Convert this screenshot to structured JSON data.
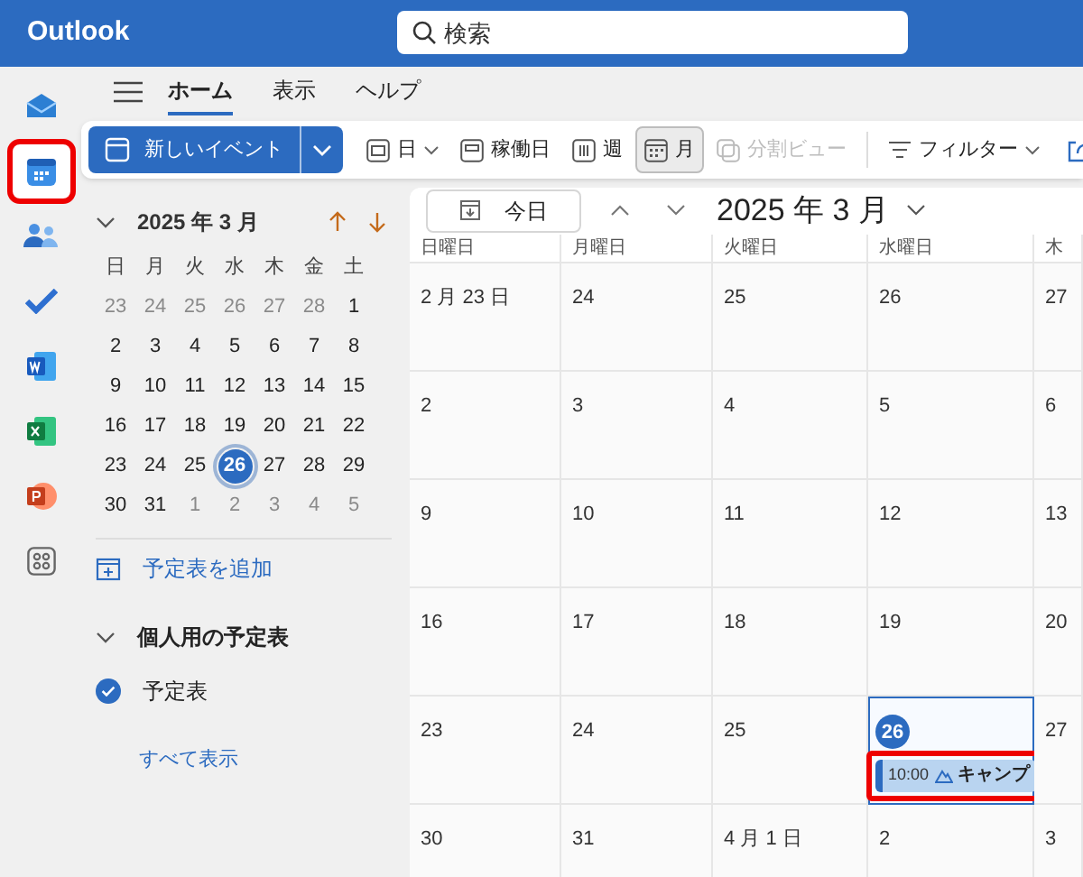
{
  "app_bar": {
    "title": "Outlook",
    "search": {
      "placeholder": "検索"
    }
  },
  "rail": [
    {
      "kind": "mail",
      "selected": false,
      "highlighted": false
    },
    {
      "kind": "calendar",
      "selected": true,
      "highlighted": true
    },
    {
      "kind": "people",
      "selected": false,
      "highlighted": false
    },
    {
      "kind": "todo",
      "selected": false,
      "highlighted": false
    },
    {
      "kind": "word",
      "selected": false,
      "highlighted": false
    },
    {
      "kind": "excel",
      "selected": false,
      "highlighted": false
    },
    {
      "kind": "powerpoint",
      "selected": false,
      "highlighted": false
    },
    {
      "kind": "apps",
      "selected": false,
      "highlighted": false
    }
  ],
  "ribbon_tabs": [
    {
      "label": "ホーム",
      "selected": true
    },
    {
      "label": "表示",
      "selected": false
    },
    {
      "label": "ヘルプ",
      "selected": false
    }
  ],
  "toolbar": {
    "new_event": "新しいイベント",
    "items": [
      {
        "kind": "day",
        "label": "日",
        "selected": false,
        "disabled": false,
        "caret": true
      },
      {
        "kind": "workweek",
        "label": "稼働日",
        "selected": false,
        "disabled": false,
        "caret": false
      },
      {
        "kind": "week",
        "label": "週",
        "selected": false,
        "disabled": false,
        "caret": false
      },
      {
        "kind": "month",
        "label": "月",
        "selected": true,
        "disabled": false,
        "caret": false
      },
      {
        "kind": "split",
        "label": "分割ビュー",
        "selected": false,
        "disabled": true,
        "caret": false
      },
      {
        "kind": "filter",
        "label": "フィルター",
        "selected": false,
        "disabled": false,
        "caret": true
      }
    ]
  },
  "mini_calendar": {
    "title": "2025 年 3 月",
    "weekdays": [
      "日",
      "月",
      "火",
      "水",
      "木",
      "金",
      "土"
    ],
    "weeks": [
      [
        {
          "day": "23",
          "other_month": true,
          "selected": false
        },
        {
          "day": "24",
          "other_month": true,
          "selected": false
        },
        {
          "day": "25",
          "other_month": true,
          "selected": false
        },
        {
          "day": "26",
          "other_month": true,
          "selected": false
        },
        {
          "day": "27",
          "other_month": true,
          "selected": false
        },
        {
          "day": "28",
          "other_month": true,
          "selected": false
        },
        {
          "day": "1",
          "other_month": false,
          "selected": false
        }
      ],
      [
        {
          "day": "2",
          "other_month": false,
          "selected": false
        },
        {
          "day": "3",
          "other_month": false,
          "selected": false
        },
        {
          "day": "4",
          "other_month": false,
          "selected": false
        },
        {
          "day": "5",
          "other_month": false,
          "selected": false
        },
        {
          "day": "6",
          "other_month": false,
          "selected": false
        },
        {
          "day": "7",
          "other_month": false,
          "selected": false
        },
        {
          "day": "8",
          "other_month": false,
          "selected": false
        }
      ],
      [
        {
          "day": "9",
          "other_month": false,
          "selected": false
        },
        {
          "day": "10",
          "other_month": false,
          "selected": false
        },
        {
          "day": "11",
          "other_month": false,
          "selected": false
        },
        {
          "day": "12",
          "other_month": false,
          "selected": false
        },
        {
          "day": "13",
          "other_month": false,
          "selected": false
        },
        {
          "day": "14",
          "other_month": false,
          "selected": false
        },
        {
          "day": "15",
          "other_month": false,
          "selected": false
        }
      ],
      [
        {
          "day": "16",
          "other_month": false,
          "selected": false
        },
        {
          "day": "17",
          "other_month": false,
          "selected": false
        },
        {
          "day": "18",
          "other_month": false,
          "selected": false
        },
        {
          "day": "19",
          "other_month": false,
          "selected": false
        },
        {
          "day": "20",
          "other_month": false,
          "selected": false
        },
        {
          "day": "21",
          "other_month": false,
          "selected": false
        },
        {
          "day": "22",
          "other_month": false,
          "selected": false
        }
      ],
      [
        {
          "day": "23",
          "other_month": false,
          "selected": false
        },
        {
          "day": "24",
          "other_month": false,
          "selected": false
        },
        {
          "day": "25",
          "other_month": false,
          "selected": false
        },
        {
          "day": "26",
          "other_month": false,
          "selected": true
        },
        {
          "day": "27",
          "other_month": false,
          "selected": false
        },
        {
          "day": "28",
          "other_month": false,
          "selected": false
        },
        {
          "day": "29",
          "other_month": false,
          "selected": false
        }
      ],
      [
        {
          "day": "30",
          "other_month": false,
          "selected": false
        },
        {
          "day": "31",
          "other_month": false,
          "selected": false
        },
        {
          "day": "1",
          "other_month": true,
          "selected": false
        },
        {
          "day": "2",
          "other_month": true,
          "selected": false
        },
        {
          "day": "3",
          "other_month": true,
          "selected": false
        },
        {
          "day": "4",
          "other_month": true,
          "selected": false
        },
        {
          "day": "5",
          "other_month": true,
          "selected": false
        }
      ]
    ]
  },
  "add_calendar": "予定表を追加",
  "calendar_group": {
    "title": "個人用の予定表",
    "expanded": true,
    "calendars": [
      {
        "name": "予定表",
        "checked": true
      }
    ]
  },
  "show_all": "すべて表示",
  "month_view": {
    "today_button": "今日",
    "title": "2025 年 3 月",
    "weekdays": [
      "日曜日",
      "月曜日",
      "火曜日",
      "水曜日",
      "木"
    ],
    "weeks": [
      [
        {
          "date": "2 月 23 日",
          "selected": false
        },
        {
          "date": "24",
          "selected": false
        },
        {
          "date": "25",
          "selected": false
        },
        {
          "date": "26",
          "selected": false
        },
        {
          "date": "27",
          "selected": false
        }
      ],
      [
        {
          "date": "2",
          "selected": false
        },
        {
          "date": "3",
          "selected": false
        },
        {
          "date": "4",
          "selected": false
        },
        {
          "date": "5",
          "selected": false
        },
        {
          "date": "6",
          "selected": false
        }
      ],
      [
        {
          "date": "9",
          "selected": false
        },
        {
          "date": "10",
          "selected": false
        },
        {
          "date": "11",
          "selected": false
        },
        {
          "date": "12",
          "selected": false
        },
        {
          "date": "13",
          "selected": false
        }
      ],
      [
        {
          "date": "16",
          "selected": false
        },
        {
          "date": "17",
          "selected": false
        },
        {
          "date": "18",
          "selected": false
        },
        {
          "date": "19",
          "selected": false
        },
        {
          "date": "20",
          "selected": false
        }
      ],
      [
        {
          "date": "23",
          "selected": false
        },
        {
          "date": "24",
          "selected": false
        },
        {
          "date": "25",
          "selected": false
        },
        {
          "date": "26",
          "selected": true,
          "events": [
            {
              "time": "10:00",
              "title": "キャンプ",
              "highlighted": true
            }
          ]
        },
        {
          "date": "27",
          "selected": false
        }
      ],
      [
        {
          "date": "30",
          "selected": false
        },
        {
          "date": "31",
          "selected": false
        },
        {
          "date": "4 月 1 日",
          "selected": false
        },
        {
          "date": "2",
          "selected": false
        },
        {
          "date": "3",
          "selected": false
        }
      ]
    ]
  }
}
